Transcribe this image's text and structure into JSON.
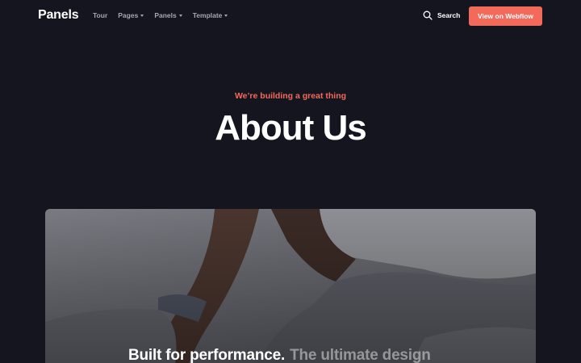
{
  "nav": {
    "logo": "Panels",
    "links": [
      {
        "label": "Tour",
        "has_dropdown": false
      },
      {
        "label": "Pages",
        "has_dropdown": true
      },
      {
        "label": "Panels",
        "has_dropdown": true
      },
      {
        "label": "Template",
        "has_dropdown": true
      }
    ],
    "search_label": "Search",
    "search_icon": "search-icon",
    "cta_label": "View on Webflow"
  },
  "hero": {
    "eyebrow": "We’re building a great thing",
    "title": "About Us",
    "overlay_strong": "Built for performance.",
    "overlay_muted": "The ultimate design"
  },
  "colors": {
    "background": "#151520",
    "accent": "#f36a5a",
    "nav_text": "#a6a7b3"
  }
}
